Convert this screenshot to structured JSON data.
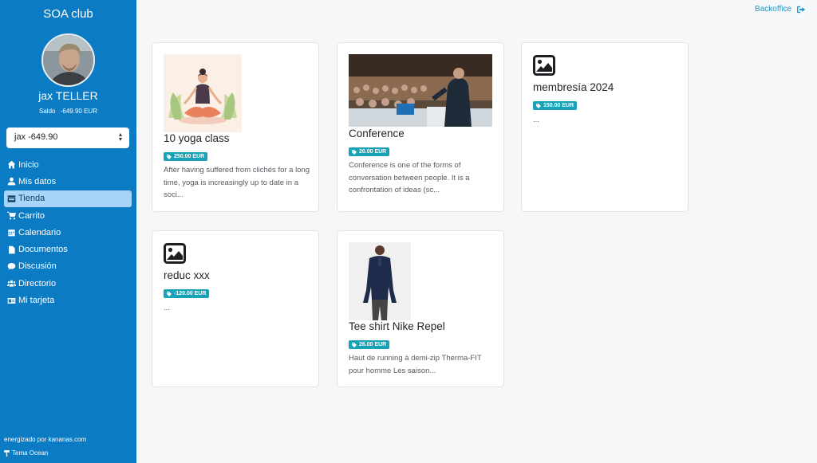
{
  "sidebar": {
    "club_name": "SOA club",
    "user_name": "jax TELLER",
    "balance_label": "Saldo",
    "balance_value": "-649.90 EUR",
    "account_select": "jax -649.90",
    "items": [
      {
        "label": "Inicio",
        "icon": "home-icon"
      },
      {
        "label": "Mis datos",
        "icon": "user-icon"
      },
      {
        "label": "Tienda",
        "icon": "store-icon",
        "active": true
      },
      {
        "label": "Carrito",
        "icon": "cart-icon"
      },
      {
        "label": "Calendario",
        "icon": "calendar-icon"
      },
      {
        "label": "Documentos",
        "icon": "file-icon"
      },
      {
        "label": "Discusión",
        "icon": "comment-icon"
      },
      {
        "label": "Directorio",
        "icon": "users-icon"
      },
      {
        "label": "Mi tarjeta",
        "icon": "id-card-icon"
      }
    ],
    "footer_credit": "energizado por kananas.com",
    "footer_theme": "Tema Ocean"
  },
  "header": {
    "backoffice_label": "Backoffice"
  },
  "products": [
    {
      "title": "10 yoga class",
      "price": "250.00 EUR",
      "description": "After having suffered from clichés for a long time, yoga is increasingly up to date in a soci...",
      "image": "yoga-illustration"
    },
    {
      "title": "Conference",
      "price": "20.00 EUR",
      "description": "Conference is one of the forms of conversation between people. It is a confrontation of ideas (sc...",
      "image": "conference-photo"
    },
    {
      "title": "membresía 2024",
      "price": "150.00 EUR",
      "description": "...",
      "image": "image-placeholder-icon"
    },
    {
      "title": "reduc xxx",
      "price": "-120.00 EUR",
      "description": "...",
      "image": "image-placeholder-icon"
    },
    {
      "title": "Tee shirt Nike Repel",
      "price": "26.00 EUR",
      "description": "Haut de running à demi-zip Therma-FIT pour homme Les saison...",
      "image": "shirt-photo"
    }
  ],
  "colors": {
    "sidebar_bg": "#0b7bc4",
    "active_item_bg": "#a8d4f7",
    "badge_bg": "#17a2b8",
    "link": "#1a9ad0"
  }
}
